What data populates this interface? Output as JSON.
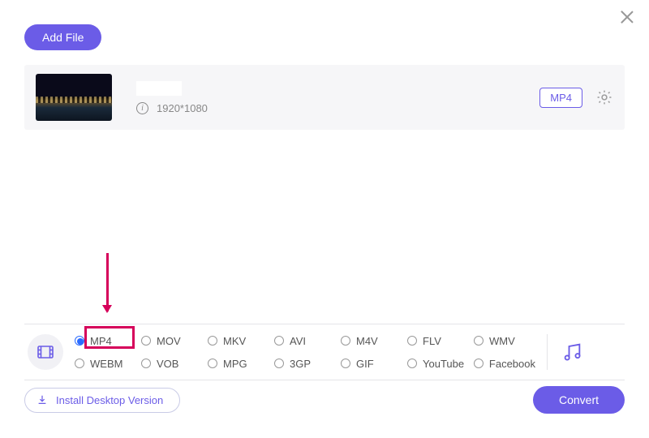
{
  "header": {
    "add_file_label": "Add File"
  },
  "file": {
    "resolution": "1920*1080",
    "format_label": "MP4"
  },
  "formats": {
    "selected": "MP4",
    "row1": [
      "MP4",
      "MOV",
      "MKV",
      "AVI",
      "M4V",
      "FLV",
      "WMV"
    ],
    "row2": [
      "WEBM",
      "VOB",
      "MPG",
      "3GP",
      "GIF",
      "YouTube",
      "Facebook"
    ]
  },
  "footer": {
    "install_label": "Install Desktop Version",
    "convert_label": "Convert"
  },
  "icons": {
    "close": "close-icon",
    "info": "info-icon",
    "gear": "gear-icon",
    "video": "video-icon",
    "audio": "music-icon",
    "download": "download-icon"
  },
  "colors": {
    "accent": "#6b5ce7",
    "highlight": "#d6005a",
    "radio_selected": "#2b6bff"
  }
}
